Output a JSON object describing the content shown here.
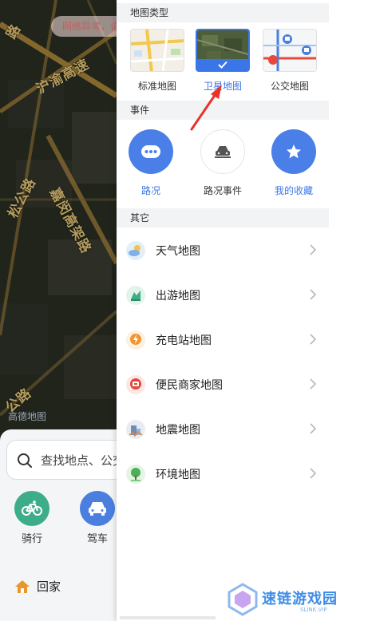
{
  "map": {
    "network_error": "网络异常，请",
    "labels": [
      "沪渝高速",
      "松公路",
      "嘉闵高架路",
      "路",
      "公路"
    ],
    "credit": "高德地图"
  },
  "bottom_card": {
    "search_placeholder": "查找地点、公交",
    "quick_actions": [
      {
        "label": "骑行",
        "icon": "bicycle-icon",
        "color": "#3cad88"
      },
      {
        "label": "驾车",
        "icon": "car-icon",
        "color": "#4a7fe0"
      }
    ],
    "home_label": "回家"
  },
  "drawer": {
    "section_map_type": "地图类型",
    "map_types": [
      {
        "label": "标准地图",
        "selected": false
      },
      {
        "label": "卫星地图",
        "selected": true
      },
      {
        "label": "公交地图",
        "selected": false
      }
    ],
    "section_events": "事件",
    "events": [
      {
        "label": "路况",
        "icon": "more-dots-icon",
        "style": "blue"
      },
      {
        "label": "路况事件",
        "icon": "road-event-icon",
        "style": "outline"
      },
      {
        "label": "我的收藏",
        "icon": "star-icon",
        "style": "blue"
      }
    ],
    "section_other": "其它",
    "other_items": [
      {
        "label": "天气地图",
        "icon": "weather-icon"
      },
      {
        "label": "出游地图",
        "icon": "travel-icon"
      },
      {
        "label": "充电站地图",
        "icon": "charging-station-icon"
      },
      {
        "label": "便民商家地图",
        "icon": "merchant-icon"
      },
      {
        "label": "地震地图",
        "icon": "earthquake-icon"
      },
      {
        "label": "环境地图",
        "icon": "environment-icon"
      }
    ]
  },
  "watermark": {
    "title": "速链游戏园",
    "subtitle": "SLINK.VIP"
  },
  "colors": {
    "accent": "#3b76e8",
    "event_blue": "#4a7fe8",
    "annotation_red": "#e8322a"
  }
}
